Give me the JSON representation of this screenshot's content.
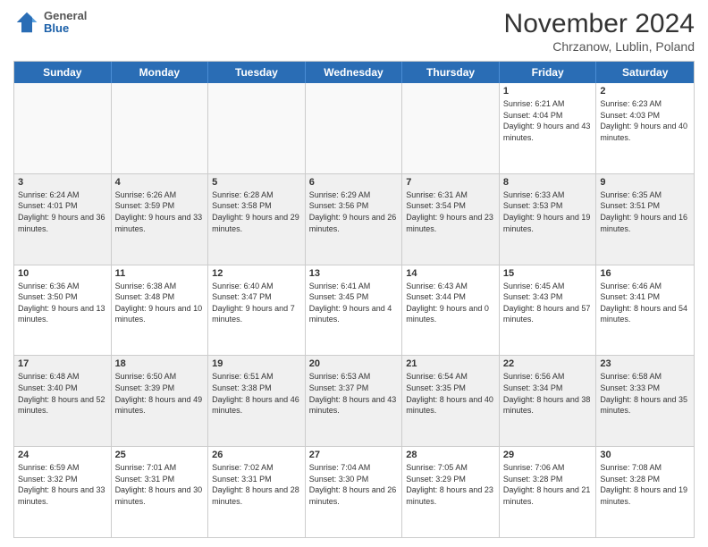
{
  "header": {
    "logo_general": "General",
    "logo_blue": "Blue",
    "month_year": "November 2024",
    "location": "Chrzanow, Lublin, Poland"
  },
  "days_of_week": [
    "Sunday",
    "Monday",
    "Tuesday",
    "Wednesday",
    "Thursday",
    "Friday",
    "Saturday"
  ],
  "weeks": [
    [
      {
        "day": "",
        "info": "",
        "empty": true
      },
      {
        "day": "",
        "info": "",
        "empty": true
      },
      {
        "day": "",
        "info": "",
        "empty": true
      },
      {
        "day": "",
        "info": "",
        "empty": true
      },
      {
        "day": "",
        "info": "",
        "empty": true
      },
      {
        "day": "1",
        "info": "Sunrise: 6:21 AM\nSunset: 4:04 PM\nDaylight: 9 hours and 43 minutes.",
        "empty": false
      },
      {
        "day": "2",
        "info": "Sunrise: 6:23 AM\nSunset: 4:03 PM\nDaylight: 9 hours and 40 minutes.",
        "empty": false
      }
    ],
    [
      {
        "day": "3",
        "info": "Sunrise: 6:24 AM\nSunset: 4:01 PM\nDaylight: 9 hours and 36 minutes.",
        "empty": false
      },
      {
        "day": "4",
        "info": "Sunrise: 6:26 AM\nSunset: 3:59 PM\nDaylight: 9 hours and 33 minutes.",
        "empty": false
      },
      {
        "day": "5",
        "info": "Sunrise: 6:28 AM\nSunset: 3:58 PM\nDaylight: 9 hours and 29 minutes.",
        "empty": false
      },
      {
        "day": "6",
        "info": "Sunrise: 6:29 AM\nSunset: 3:56 PM\nDaylight: 9 hours and 26 minutes.",
        "empty": false
      },
      {
        "day": "7",
        "info": "Sunrise: 6:31 AM\nSunset: 3:54 PM\nDaylight: 9 hours and 23 minutes.",
        "empty": false
      },
      {
        "day": "8",
        "info": "Sunrise: 6:33 AM\nSunset: 3:53 PM\nDaylight: 9 hours and 19 minutes.",
        "empty": false
      },
      {
        "day": "9",
        "info": "Sunrise: 6:35 AM\nSunset: 3:51 PM\nDaylight: 9 hours and 16 minutes.",
        "empty": false
      }
    ],
    [
      {
        "day": "10",
        "info": "Sunrise: 6:36 AM\nSunset: 3:50 PM\nDaylight: 9 hours and 13 minutes.",
        "empty": false
      },
      {
        "day": "11",
        "info": "Sunrise: 6:38 AM\nSunset: 3:48 PM\nDaylight: 9 hours and 10 minutes.",
        "empty": false
      },
      {
        "day": "12",
        "info": "Sunrise: 6:40 AM\nSunset: 3:47 PM\nDaylight: 9 hours and 7 minutes.",
        "empty": false
      },
      {
        "day": "13",
        "info": "Sunrise: 6:41 AM\nSunset: 3:45 PM\nDaylight: 9 hours and 4 minutes.",
        "empty": false
      },
      {
        "day": "14",
        "info": "Sunrise: 6:43 AM\nSunset: 3:44 PM\nDaylight: 9 hours and 0 minutes.",
        "empty": false
      },
      {
        "day": "15",
        "info": "Sunrise: 6:45 AM\nSunset: 3:43 PM\nDaylight: 8 hours and 57 minutes.",
        "empty": false
      },
      {
        "day": "16",
        "info": "Sunrise: 6:46 AM\nSunset: 3:41 PM\nDaylight: 8 hours and 54 minutes.",
        "empty": false
      }
    ],
    [
      {
        "day": "17",
        "info": "Sunrise: 6:48 AM\nSunset: 3:40 PM\nDaylight: 8 hours and 52 minutes.",
        "empty": false
      },
      {
        "day": "18",
        "info": "Sunrise: 6:50 AM\nSunset: 3:39 PM\nDaylight: 8 hours and 49 minutes.",
        "empty": false
      },
      {
        "day": "19",
        "info": "Sunrise: 6:51 AM\nSunset: 3:38 PM\nDaylight: 8 hours and 46 minutes.",
        "empty": false
      },
      {
        "day": "20",
        "info": "Sunrise: 6:53 AM\nSunset: 3:37 PM\nDaylight: 8 hours and 43 minutes.",
        "empty": false
      },
      {
        "day": "21",
        "info": "Sunrise: 6:54 AM\nSunset: 3:35 PM\nDaylight: 8 hours and 40 minutes.",
        "empty": false
      },
      {
        "day": "22",
        "info": "Sunrise: 6:56 AM\nSunset: 3:34 PM\nDaylight: 8 hours and 38 minutes.",
        "empty": false
      },
      {
        "day": "23",
        "info": "Sunrise: 6:58 AM\nSunset: 3:33 PM\nDaylight: 8 hours and 35 minutes.",
        "empty": false
      }
    ],
    [
      {
        "day": "24",
        "info": "Sunrise: 6:59 AM\nSunset: 3:32 PM\nDaylight: 8 hours and 33 minutes.",
        "empty": false
      },
      {
        "day": "25",
        "info": "Sunrise: 7:01 AM\nSunset: 3:31 PM\nDaylight: 8 hours and 30 minutes.",
        "empty": false
      },
      {
        "day": "26",
        "info": "Sunrise: 7:02 AM\nSunset: 3:31 PM\nDaylight: 8 hours and 28 minutes.",
        "empty": false
      },
      {
        "day": "27",
        "info": "Sunrise: 7:04 AM\nSunset: 3:30 PM\nDaylight: 8 hours and 26 minutes.",
        "empty": false
      },
      {
        "day": "28",
        "info": "Sunrise: 7:05 AM\nSunset: 3:29 PM\nDaylight: 8 hours and 23 minutes.",
        "empty": false
      },
      {
        "day": "29",
        "info": "Sunrise: 7:06 AM\nSunset: 3:28 PM\nDaylight: 8 hours and 21 minutes.",
        "empty": false
      },
      {
        "day": "30",
        "info": "Sunrise: 7:08 AM\nSunset: 3:28 PM\nDaylight: 8 hours and 19 minutes.",
        "empty": false
      }
    ]
  ]
}
